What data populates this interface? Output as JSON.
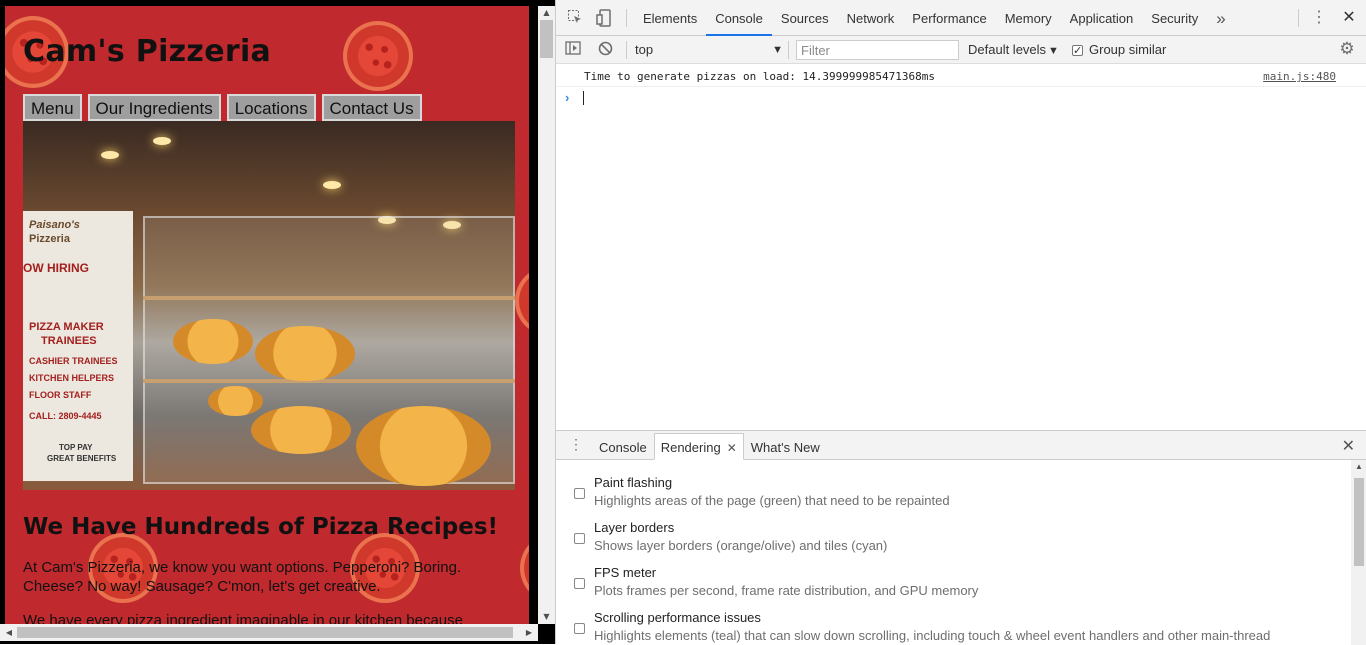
{
  "site": {
    "title": "Cam's Pizzeria",
    "nav": [
      "Menu",
      "Our Ingredients",
      "Locations",
      "Contact Us"
    ],
    "hero_banner_lines": [
      "Paisano's",
      "Pizzeria",
      "OW HIRING",
      "PIZZA MAKER",
      "TRAINEES",
      "CASHIER TRAINEES",
      "KITCHEN HELPERS",
      "FLOOR STAFF",
      "CALL: 2809-4445",
      "TOP PAY",
      "GREAT BENEFITS"
    ],
    "heading": "We Have Hundreds of Pizza Recipes!",
    "para1": "At Cam's Pizzeria, we know you want options. Pepperoni? Boring. Cheese? No way! Sausage? C'mon, let's get creative.",
    "para2": "We have every pizza ingredient imaginable in our kitchen because"
  },
  "devtools": {
    "tabs": [
      "Elements",
      "Console",
      "Sources",
      "Network",
      "Performance",
      "Memory",
      "Application",
      "Security"
    ],
    "active_tab": "Console",
    "more_tabs_icon": "»",
    "toolbar": {
      "context": "top",
      "filter_placeholder": "Filter",
      "levels": "Default levels",
      "group_similar": "Group similar",
      "group_similar_checked": true
    },
    "console": {
      "messages": [
        {
          "text": "Time to generate pizzas on load: 14.399999985471368ms",
          "source": "main.js:480"
        }
      ],
      "prompt": "›"
    },
    "drawer": {
      "tabs": [
        "Console",
        "Rendering",
        "What's New"
      ],
      "active_tab": "Rendering",
      "options": [
        {
          "title": "Paint flashing",
          "desc": "Highlights areas of the page (green) that need to be repainted",
          "checked": false
        },
        {
          "title": "Layer borders",
          "desc": "Shows layer borders (orange/olive) and tiles (cyan)",
          "checked": false
        },
        {
          "title": "FPS meter",
          "desc": "Plots frames per second, frame rate distribution, and GPU memory",
          "checked": false
        },
        {
          "title": "Scrolling performance issues",
          "desc": "Highlights elements (teal) that can slow down scrolling, including touch & wheel event handlers and other main-thread",
          "checked": false
        }
      ]
    },
    "colors": {
      "accent": "#1a73e8",
      "toolbar_bg": "#f3f3f3",
      "site_bg": "#c0292d"
    }
  }
}
